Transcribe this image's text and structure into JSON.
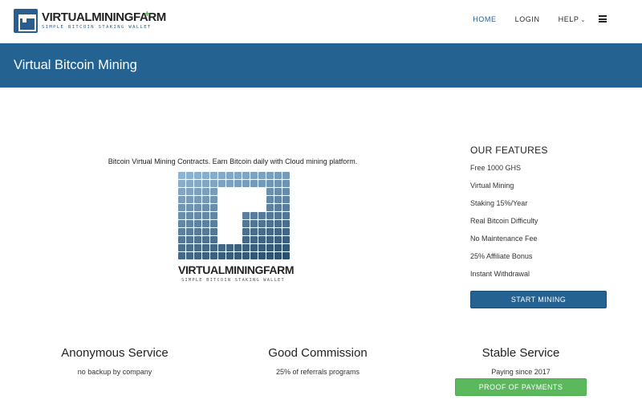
{
  "brand": {
    "name": "VIRTUALMININGFARM",
    "tagline": "SIMPLE BITCOIN STAKING WALLET"
  },
  "nav": {
    "home": "HOME",
    "login": "LOGIN",
    "help": "HELP"
  },
  "banner": {
    "title": "Virtual Bitcoin Mining"
  },
  "intro": {
    "text": "Bitcoin Virtual Mining Contracts. Earn Bitcoin daily with Cloud mining platform."
  },
  "features": {
    "heading": "OUR FEATURES",
    "items": [
      "Free 1000 GHS",
      "Virtual Mining",
      "Staking 15%/Year",
      "Real Bitcoin Difficulty",
      "No Maintenance Fee",
      "25% Affiliate Bonus",
      "Instant Withdrawal"
    ],
    "cta": "START MINING"
  },
  "columns": [
    {
      "title": "Anonymous Service",
      "text": "no backup by company"
    },
    {
      "title": "Good Commission",
      "text": "25% of referrals programs"
    },
    {
      "title": "Stable Service",
      "text": "Paying since 2017"
    }
  ],
  "proof_button": "PROOF OF PAYMENTS",
  "colors": {
    "primary": "#246292",
    "success": "#5cb85c",
    "mosaic_light": "#8fb3d1",
    "mosaic_dark": "#2b4f6e"
  }
}
